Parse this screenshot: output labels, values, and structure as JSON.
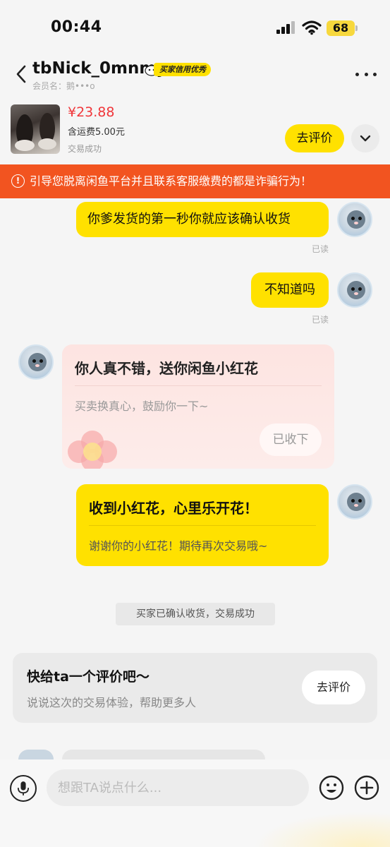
{
  "status_bar": {
    "time": "00:44",
    "battery": "68"
  },
  "header": {
    "nickname": "tbNick_0mnmy",
    "credit_badge": "买家信用优秀",
    "member_label": "会员名：鹅•••o"
  },
  "product": {
    "price": "¥23.88",
    "shipping": "含运费5.00元",
    "status": "交易成功",
    "review_button": "去评价"
  },
  "warning": {
    "text": "引导您脱离闲鱼平台并且联系客服缴费的都是诈骗行为！"
  },
  "messages": [
    {
      "text": "你爹发货的第一秒你就应该确认收货",
      "read": "已读"
    },
    {
      "text": "不知道吗",
      "read": "已读"
    }
  ],
  "flower_card": {
    "title": "你人真不错，送你闲鱼小红花",
    "subtitle": "买卖换真心，鼓励你一下~",
    "button": "已收下"
  },
  "reply_card": {
    "title": "收到小红花，心里乐开花！",
    "subtitle": "谢谢你的小红花！期待再次交易哦~"
  },
  "system_message": "买家已确认收货，交易成功",
  "rate_card": {
    "title": "快给ta一个评价吧～",
    "subtitle": "说说这次的交易体验，帮助更多人",
    "button": "去评价"
  },
  "input": {
    "placeholder": "想跟TA说点什么..."
  },
  "colors": {
    "accent_yellow": "#ffe100",
    "warning_orange": "#f25420",
    "price_red": "#f0363a"
  }
}
